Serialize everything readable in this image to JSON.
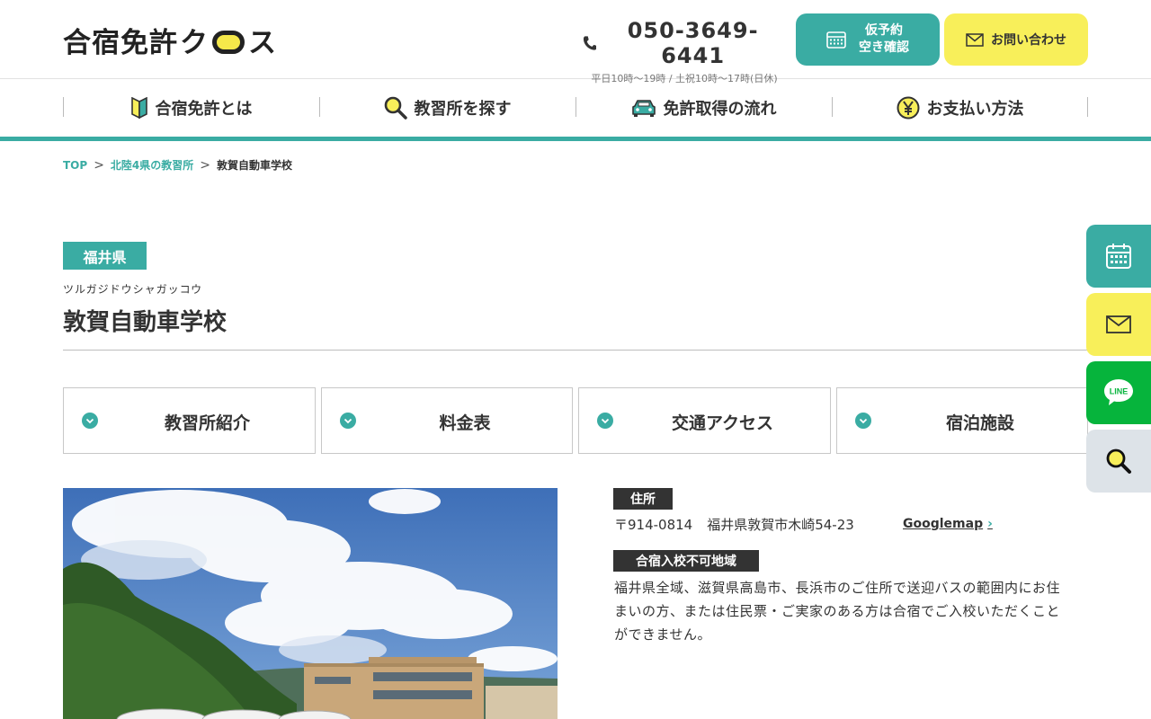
{
  "header": {
    "logo_text_1": "合宿免許",
    "logo_text_2": "ク",
    "logo_text_3": "ス",
    "phone": "050-3649-6441",
    "hours": "平日10時〜19時 / 土祝10時〜17時(日休)",
    "reserve_line1": "仮予約",
    "reserve_line2": "空き確認",
    "contact_label": "お問い合わせ"
  },
  "nav": {
    "items": [
      {
        "label": "合宿免許とは",
        "icon": "beginner-mark-icon"
      },
      {
        "label": "教習所を探す",
        "icon": "search-icon"
      },
      {
        "label": "免許取得の流れ",
        "icon": "car-icon"
      },
      {
        "label": "お支払い方法",
        "icon": "yen-icon"
      }
    ]
  },
  "breadcrumb": {
    "items": [
      "TOP",
      "北陸4県の教習所"
    ],
    "separator": ">",
    "current": "敦賀自動車学校"
  },
  "school": {
    "prefecture": "福井県",
    "kana": "ツルガジドウシャガッコウ",
    "name": "敦賀自動車学校"
  },
  "anchors": [
    "教習所紹介",
    "料金表",
    "交通アクセス",
    "宿泊施設"
  ],
  "side_buttons": [
    {
      "icon": "calendar-icon",
      "color": "#3aaca3"
    },
    {
      "icon": "mail-icon",
      "color": "#f8ef5a"
    },
    {
      "icon": "line-icon",
      "color": "#06b43c",
      "label": "LINE"
    },
    {
      "icon": "search-icon",
      "color": "#dde3e8"
    }
  ],
  "info": {
    "address_label": "住所",
    "postal": "〒914-0814",
    "address": "福井県敦賀市木崎54-23",
    "map_link": "Googlemap",
    "restriction_label": "合宿入校不可地域",
    "restriction_text": "福井県全域、滋賀県高島市、長浜市のご住所で送迎バスの範囲内にお住まいの方、または住民票・ご実家のある方は合宿でご入校いただくことができません。"
  },
  "colors": {
    "teal": "#3aaca3",
    "yellow": "#f8ef5a",
    "line_green": "#06b43c",
    "dark": "#333333"
  }
}
